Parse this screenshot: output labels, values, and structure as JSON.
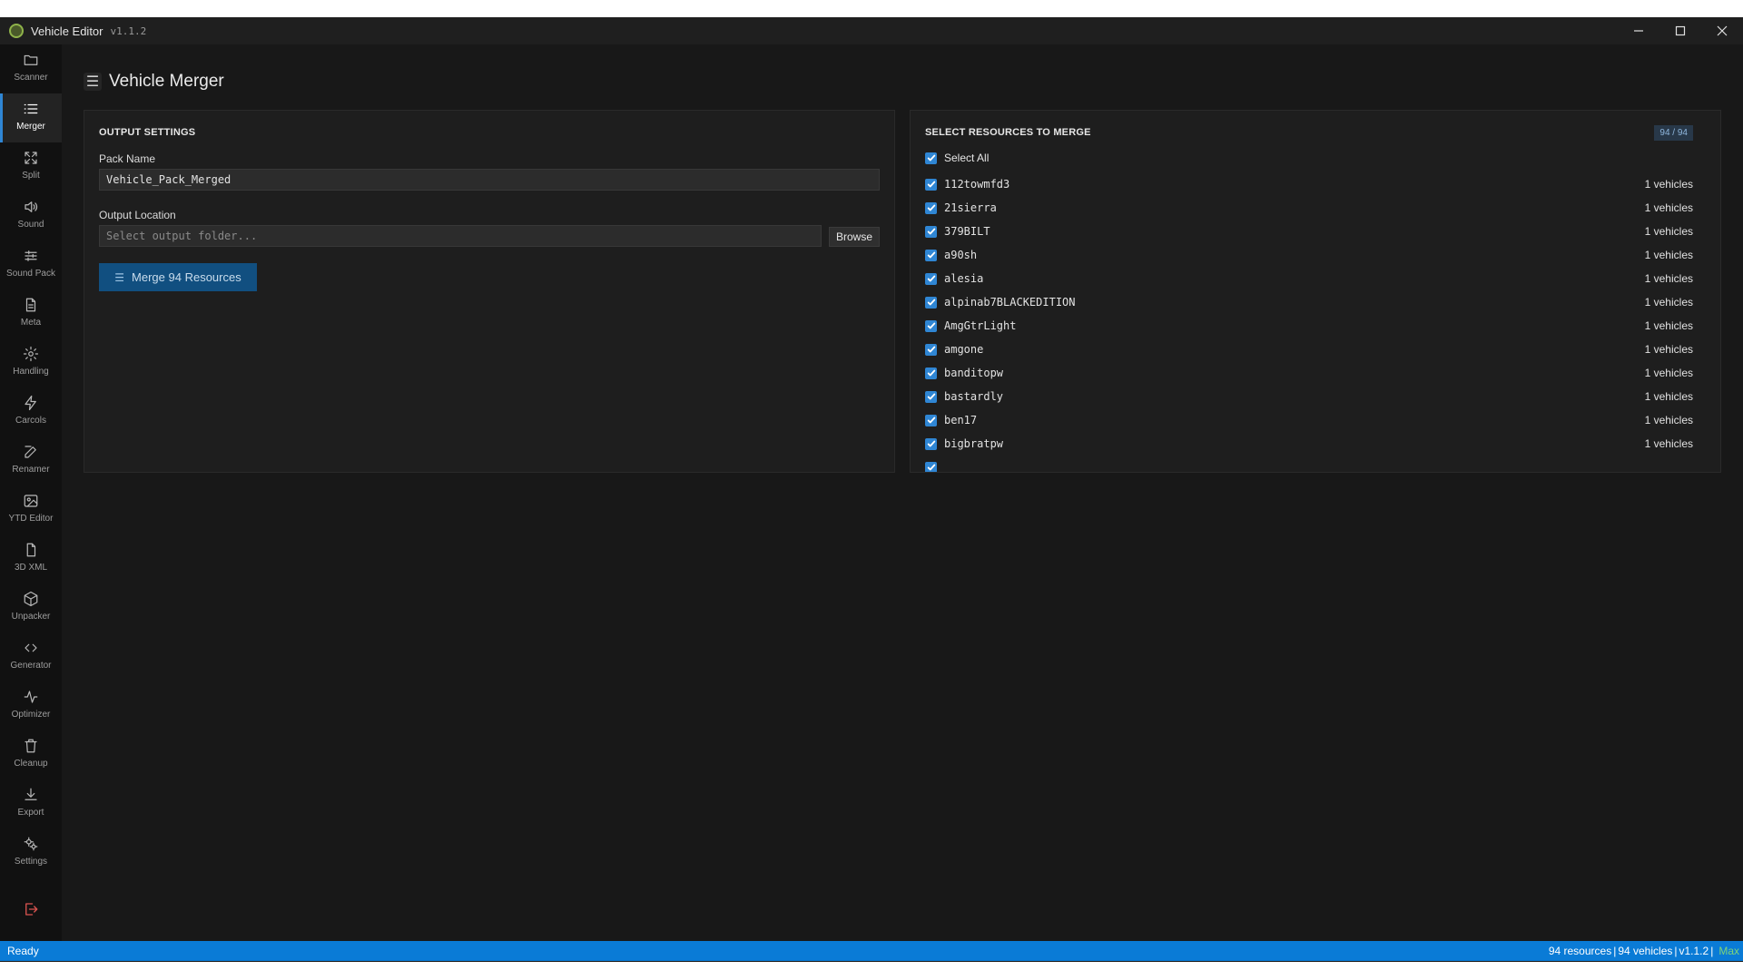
{
  "window": {
    "title": "Vehicle Editor",
    "version": "v1.1.2",
    "controls": [
      "minimize-icon",
      "maximize-icon",
      "close-icon"
    ]
  },
  "sidebar": {
    "items": [
      {
        "label": "Scanner",
        "icon": "folder-icon",
        "active": false
      },
      {
        "label": "Merger",
        "icon": "list-icon",
        "active": true
      },
      {
        "label": "Split",
        "icon": "expand-icon",
        "active": false
      },
      {
        "label": "Sound",
        "icon": "speaker-icon",
        "active": false
      },
      {
        "label": "Sound Pack",
        "icon": "sliders-icon",
        "active": false
      },
      {
        "label": "Meta",
        "icon": "document-icon",
        "active": false
      },
      {
        "label": "Handling",
        "icon": "gear-icon",
        "active": false
      },
      {
        "label": "Carcols",
        "icon": "lightning-icon",
        "active": false
      },
      {
        "label": "Renamer",
        "icon": "edit-icon",
        "active": false
      },
      {
        "label": "YTD Editor",
        "icon": "image-icon",
        "active": false
      },
      {
        "label": "3D XML",
        "icon": "file-icon",
        "active": false
      },
      {
        "label": "Unpacker",
        "icon": "box-icon",
        "active": false
      },
      {
        "label": "Generator",
        "icon": "code-icon",
        "active": false
      },
      {
        "label": "Optimizer",
        "icon": "pulse-icon",
        "active": false
      },
      {
        "label": "Cleanup",
        "icon": "trash-icon",
        "active": false
      },
      {
        "label": "Export",
        "icon": "download-icon",
        "active": false
      },
      {
        "label": "Settings",
        "icon": "gears-icon",
        "active": false
      }
    ],
    "logout_icon": "logout-icon"
  },
  "header": {
    "title": "Vehicle Merger",
    "icon": "menu-icon"
  },
  "output": {
    "section_title": "OUTPUT SETTINGS",
    "pack_name_label": "Pack Name",
    "pack_name_value": "Vehicle_Pack_Merged",
    "location_label": "Output Location",
    "location_placeholder": "Select output folder...",
    "browse_label": "Browse",
    "merge_label": "Merge 94 Resources"
  },
  "resources": {
    "section_title": "SELECT RESOURCES TO MERGE",
    "count": "94 / 94",
    "select_all_label": "Select All",
    "items": [
      {
        "name": "112towmfd3",
        "count": "1 vehicles",
        "checked": true
      },
      {
        "name": "21sierra",
        "count": "1 vehicles",
        "checked": true
      },
      {
        "name": "379BILT",
        "count": "1 vehicles",
        "checked": true
      },
      {
        "name": "a90sh",
        "count": "1 vehicles",
        "checked": true
      },
      {
        "name": "alesia",
        "count": "1 vehicles",
        "checked": true
      },
      {
        "name": "alpinab7BLACKEDITION",
        "count": "1 vehicles",
        "checked": true
      },
      {
        "name": "AmgGtrLight",
        "count": "1 vehicles",
        "checked": true
      },
      {
        "name": "amgone",
        "count": "1 vehicles",
        "checked": true
      },
      {
        "name": "banditopw",
        "count": "1 vehicles",
        "checked": true
      },
      {
        "name": "bastardly",
        "count": "1 vehicles",
        "checked": true
      },
      {
        "name": "ben17",
        "count": "1 vehicles",
        "checked": true
      },
      {
        "name": "bigbratpw",
        "count": "1 vehicles",
        "checked": true
      },
      {
        "name": "",
        "count": "",
        "checked": true
      }
    ]
  },
  "status": {
    "left": "Ready",
    "resources": "94 resources",
    "vehicles": "94 vehicles",
    "version": "v1.1.2",
    "accent": "Max"
  },
  "colors": {
    "accent": "#2f86d4",
    "statusbar": "#0a7bd6",
    "merge_button": "#114f80",
    "danger": "#d9534f"
  }
}
